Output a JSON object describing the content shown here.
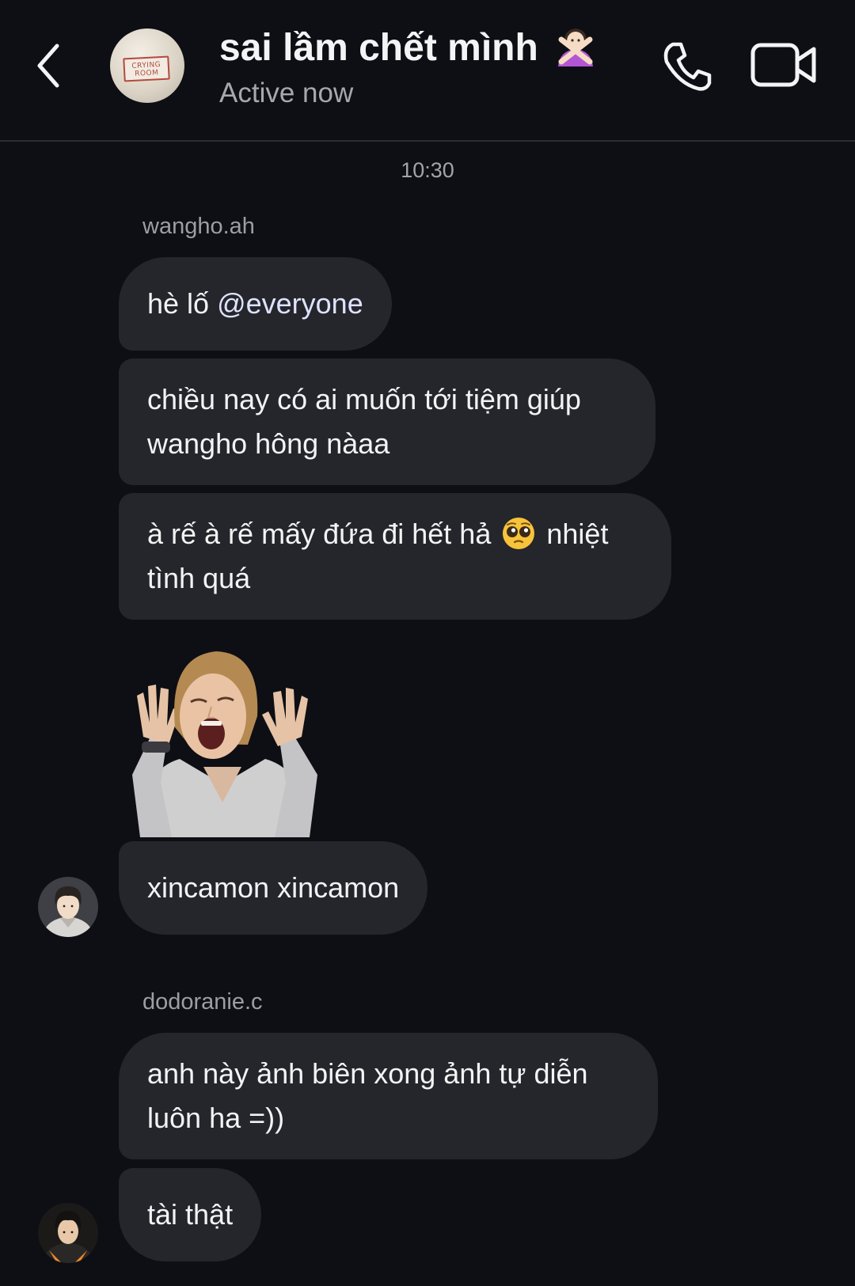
{
  "header": {
    "title": "sai lầm chết mình",
    "title_emoji_icon": "person-gesturing-no-icon",
    "status": "Active now",
    "group_avatar_sign": "CRYING ROOM",
    "icons": [
      "back-chevron-icon",
      "phone-icon",
      "video-camera-icon"
    ]
  },
  "conversation": {
    "timestamp": "10:30",
    "groups": [
      {
        "sender": "wangho.ah",
        "messages": [
          {
            "text_before": "hè lố ",
            "mention": "@everyone"
          },
          {
            "text": "chiều nay có ai muốn tới tiệm giúp wangho hông nàaa"
          },
          {
            "text_before": "à rế à rế mấy đứa đi hết hả",
            "emoji": "pleading-face-icon",
            "text_after": "nhiệt tình quá"
          },
          {
            "sticker": "screaming-woman-sticker"
          },
          {
            "text": "xincamon xincamon"
          }
        ]
      },
      {
        "sender": "dodoranie.c",
        "messages": [
          {
            "text": "anh này ảnh biên xong ảnh tự diễn luôn ha =))"
          },
          {
            "text": "tài thật"
          }
        ]
      }
    ]
  },
  "colors": {
    "background": "#0e0f14",
    "bubble": "#25262b",
    "text": "#f3f3f5",
    "secondary_text": "#a7a8ae"
  }
}
